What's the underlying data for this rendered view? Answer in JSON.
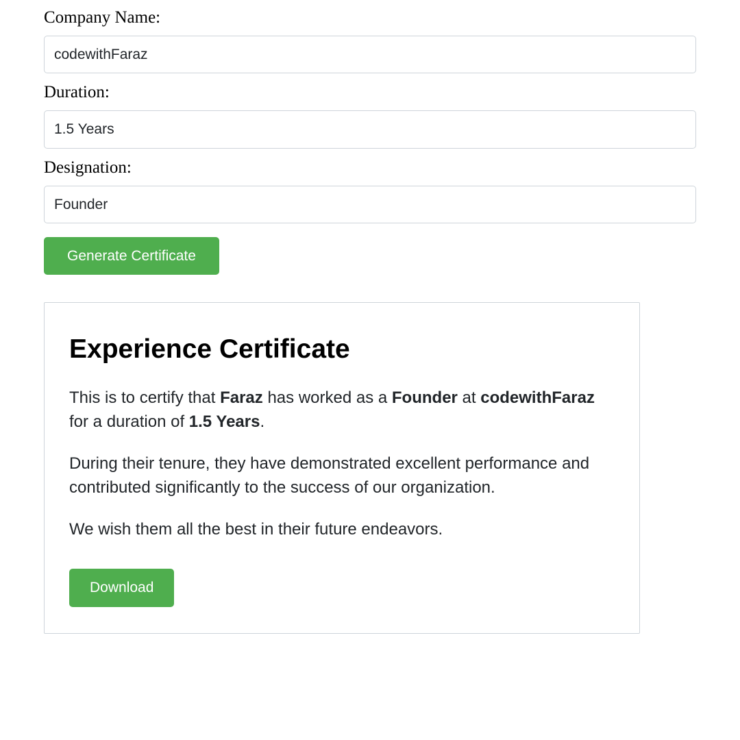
{
  "form": {
    "company_label": "Company Name:",
    "company_value": "codewithFaraz",
    "duration_label": "Duration:",
    "duration_value": "1.5 Years",
    "designation_label": "Designation:",
    "designation_value": "Founder",
    "generate_button": "Generate Certificate"
  },
  "certificate": {
    "title": "Experience Certificate",
    "p1_part1": "This is to certify that ",
    "p1_name": "Faraz",
    "p1_part2": " has worked as a ",
    "p1_designation": "Founder",
    "p1_part3": " at ",
    "p1_company": "codewithFaraz",
    "p1_part4": " for a duration of ",
    "p1_duration": "1.5 Years",
    "p1_part5": ".",
    "p2": "During their tenure, they have demonstrated excellent performance and contributed significantly to the success of our organization.",
    "p3": "We wish them all the best in their future endeavors.",
    "download_button": "Download"
  }
}
